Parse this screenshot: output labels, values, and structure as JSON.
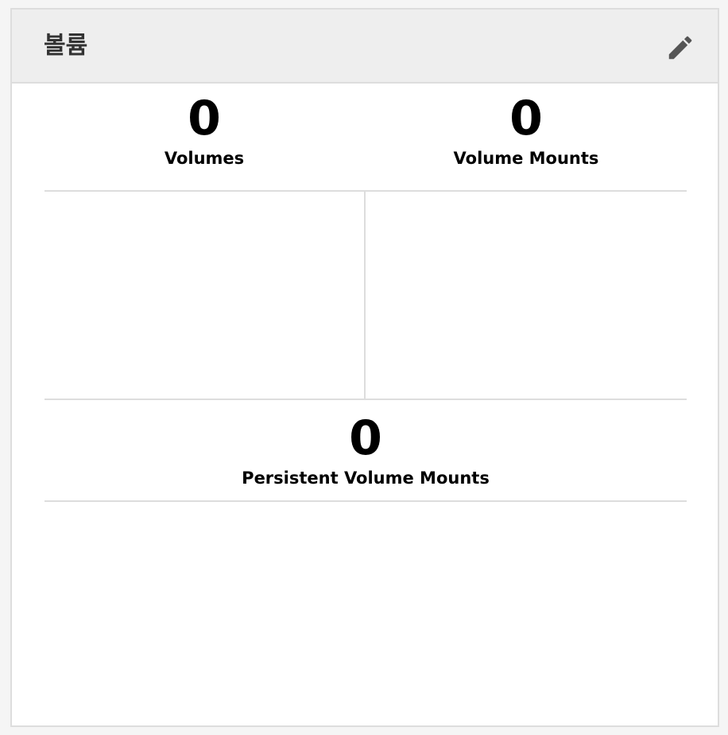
{
  "card": {
    "title": "볼륨",
    "edit_icon": "pencil-icon"
  },
  "stats": {
    "volumes": {
      "value": "0",
      "label": "Volumes"
    },
    "volume_mounts": {
      "value": "0",
      "label": "Volume Mounts"
    },
    "persistent_volume_mounts": {
      "value": "0",
      "label": "Persistent Volume Mounts"
    }
  },
  "colors": {
    "header_bg": "#eeeeee",
    "border": "#dddddd",
    "icon": "#555555",
    "text": "#000000"
  }
}
